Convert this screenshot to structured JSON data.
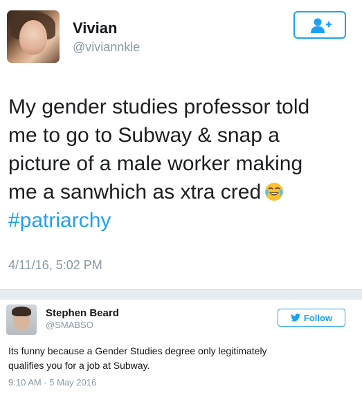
{
  "main_tweet": {
    "author_name": "Vivian",
    "author_handle": "@viviannkle",
    "text_lines": [
      "My gender studies professor told",
      "me to go to Subway & snap a",
      "picture of a male worker making",
      "me a sanwhich as xtra cred"
    ],
    "emoji": "face-with-tears-of-joy",
    "hashtag": "#patriarchy",
    "timestamp": "4/11/16, 5:02 PM",
    "follow_icon": "add-user-icon"
  },
  "reply_tweet": {
    "author_name": "Stephen Beard",
    "author_handle": "@SMABSO",
    "follow_label": "Follow",
    "text_lines": [
      "Its funny because a Gender Studies degree only legitimately",
      "qualifies you for a job at Subway."
    ],
    "timestamp": "9:10 AM - 5 May 2016"
  },
  "colors": {
    "accent": "#1da1f2",
    "secondary_text": "#8899a6",
    "divider": "#e6ecf0"
  }
}
